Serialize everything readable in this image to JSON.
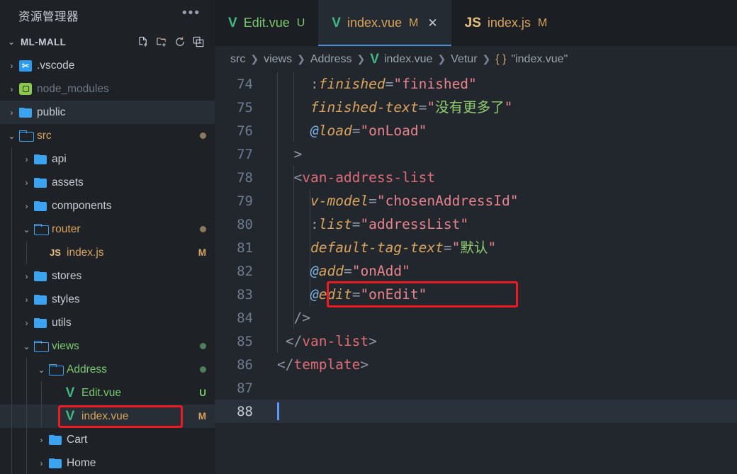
{
  "sidebar": {
    "title": "资源管理器",
    "more_icon": "ellipsis-icon",
    "root": {
      "name": "ML-MALL",
      "chevron": "⌄",
      "actions": [
        {
          "name": "new-file-icon",
          "tooltip": "New File"
        },
        {
          "name": "new-folder-icon",
          "tooltip": "New Folder"
        },
        {
          "name": "refresh-icon",
          "tooltip": "Refresh Explorer"
        },
        {
          "name": "collapse-all-icon",
          "tooltip": "Collapse Folders in Explorer"
        }
      ]
    },
    "items": [
      {
        "label": ".vscode",
        "type": "folder",
        "icon": "vscode-folder-icon",
        "chevron": "›",
        "indent": 1,
        "badge": "",
        "dot": "",
        "selected": false,
        "color": "#c8ccd4"
      },
      {
        "label": "node_modules",
        "type": "folder",
        "icon": "node-folder-icon",
        "chevron": "›",
        "indent": 1,
        "badge": "",
        "dot": "",
        "selected": false,
        "color": "#6f7783"
      },
      {
        "label": "public",
        "type": "folder",
        "icon": "folder-icon",
        "chevron": "›",
        "indent": 1,
        "badge": "",
        "dot": "",
        "selected": true,
        "color": "#c8ccd4"
      },
      {
        "label": "src",
        "type": "folder-open",
        "icon": "folder-open-icon",
        "chevron": "⌄",
        "indent": 1,
        "badge": "",
        "dot": "#8a7a5c",
        "selected": false,
        "color": "#d9a35c"
      },
      {
        "label": "api",
        "type": "folder",
        "icon": "folder-icon",
        "chevron": "›",
        "indent": 2,
        "badge": "",
        "dot": "",
        "selected": false,
        "color": "#c8ccd4"
      },
      {
        "label": "assets",
        "type": "folder",
        "icon": "folder-icon",
        "chevron": "›",
        "indent": 2,
        "badge": "",
        "dot": "",
        "selected": false,
        "color": "#c8ccd4"
      },
      {
        "label": "components",
        "type": "folder",
        "icon": "folder-icon",
        "chevron": "›",
        "indent": 2,
        "badge": "",
        "dot": "",
        "selected": false,
        "color": "#c8ccd4"
      },
      {
        "label": "router",
        "type": "folder-open",
        "icon": "folder-open-icon",
        "chevron": "⌄",
        "indent": 2,
        "badge": "",
        "dot": "#8a7a5c",
        "selected": false,
        "color": "#d9a35c"
      },
      {
        "label": "index.js",
        "type": "file-js",
        "icon": "js-file-icon",
        "chevron": "",
        "indent": 3,
        "badge": "M",
        "dot": "",
        "selected": false,
        "color": "#d9a35c",
        "badge_color": "#d9a35c"
      },
      {
        "label": "stores",
        "type": "folder",
        "icon": "folder-icon",
        "chevron": "›",
        "indent": 2,
        "badge": "",
        "dot": "",
        "selected": false,
        "color": "#c8ccd4"
      },
      {
        "label": "styles",
        "type": "folder",
        "icon": "folder-icon",
        "chevron": "›",
        "indent": 2,
        "badge": "",
        "dot": "",
        "selected": false,
        "color": "#c8ccd4"
      },
      {
        "label": "utils",
        "type": "folder",
        "icon": "folder-icon",
        "chevron": "›",
        "indent": 2,
        "badge": "",
        "dot": "",
        "selected": false,
        "color": "#c8ccd4"
      },
      {
        "label": "views",
        "type": "folder-open",
        "icon": "folder-open-icon",
        "chevron": "⌄",
        "indent": 2,
        "badge": "",
        "dot": "#4f7d5c",
        "selected": false,
        "color": "#7bc96f"
      },
      {
        "label": "Address",
        "type": "folder-open",
        "icon": "folder-open-icon",
        "chevron": "⌄",
        "indent": 3,
        "badge": "",
        "dot": "#4f7d5c",
        "selected": false,
        "color": "#7bc96f"
      },
      {
        "label": "Edit.vue",
        "type": "file-vue",
        "icon": "vue-file-icon",
        "chevron": "",
        "indent": 4,
        "badge": "U",
        "dot": "",
        "selected": false,
        "color": "#7bc96f",
        "badge_color": "#7bc96f"
      },
      {
        "label": "index.vue",
        "type": "file-vue",
        "icon": "vue-file-icon",
        "chevron": "",
        "indent": 4,
        "badge": "M",
        "dot": "",
        "selected": true,
        "color": "#d9a35c",
        "badge_color": "#d9a35c",
        "highlighted": true
      },
      {
        "label": "Cart",
        "type": "folder",
        "icon": "folder-icon",
        "chevron": "›",
        "indent": 3,
        "badge": "",
        "dot": "",
        "selected": false,
        "color": "#c8ccd4"
      },
      {
        "label": "Home",
        "type": "folder",
        "icon": "folder-icon",
        "chevron": "›",
        "indent": 3,
        "badge": "",
        "dot": "",
        "selected": false,
        "color": "#c8ccd4"
      }
    ]
  },
  "tabs": [
    {
      "name": "Edit.vue",
      "mark": "U",
      "icon": "vue-file-icon",
      "active": false,
      "closable": false,
      "color": "#7bc96f",
      "mark_color": "#7bc96f"
    },
    {
      "name": "index.vue",
      "mark": "M",
      "icon": "vue-file-icon",
      "active": true,
      "closable": true,
      "close_icon": "close-icon",
      "color": "#d9a35c",
      "mark_color": "#d9a35c"
    },
    {
      "name": "index.js",
      "mark": "M",
      "icon": "js-file-icon",
      "active": false,
      "closable": false,
      "color": "#d9a35c",
      "mark_color": "#d9a35c"
    }
  ],
  "breadcrumb": [
    {
      "label": "src",
      "icon": ""
    },
    {
      "label": "views",
      "icon": ""
    },
    {
      "label": "Address",
      "icon": ""
    },
    {
      "label": "index.vue",
      "icon": "vue-file-icon"
    },
    {
      "label": "Vetur",
      "icon": ""
    },
    {
      "label": "\"index.vue\"",
      "icon": "braces-icon"
    }
  ],
  "editor": {
    "first_line": 74,
    "cursor_line": 88,
    "lines": [
      {
        "num": "74",
        "indent_guides": 2,
        "tokens": [
          {
            "t": "    ",
            "c": "punct"
          },
          {
            "t": ":",
            "c": "punct"
          },
          {
            "t": "finished",
            "c": "attr"
          },
          {
            "t": "=",
            "c": "eq"
          },
          {
            "t": "\"finished\"",
            "c": "str"
          }
        ]
      },
      {
        "num": "75",
        "indent_guides": 2,
        "tokens": [
          {
            "t": "    ",
            "c": "punct"
          },
          {
            "t": "finished-text",
            "c": "attr"
          },
          {
            "t": "=",
            "c": "eq"
          },
          {
            "t": "\"",
            "c": "str"
          },
          {
            "t": "没有更多了",
            "c": "cjk"
          },
          {
            "t": "\"",
            "c": "str"
          }
        ]
      },
      {
        "num": "76",
        "indent_guides": 2,
        "tokens": [
          {
            "t": "    ",
            "c": "punct"
          },
          {
            "t": "@",
            "c": "at"
          },
          {
            "t": "load",
            "c": "attr"
          },
          {
            "t": "=",
            "c": "eq"
          },
          {
            "t": "\"onLoad\"",
            "c": "str"
          }
        ]
      },
      {
        "num": "77",
        "indent_guides": 1,
        "tokens": [
          {
            "t": "  ",
            "c": "punct"
          },
          {
            "t": ">",
            "c": "punct"
          }
        ]
      },
      {
        "num": "78",
        "indent_guides": 2,
        "tokens": [
          {
            "t": "  ",
            "c": "punct"
          },
          {
            "t": "<",
            "c": "punct"
          },
          {
            "t": "van-address-list",
            "c": "tag"
          }
        ]
      },
      {
        "num": "79",
        "indent_guides": 3,
        "tokens": [
          {
            "t": "    ",
            "c": "punct"
          },
          {
            "t": "v-model",
            "c": "attr"
          },
          {
            "t": "=",
            "c": "eq"
          },
          {
            "t": "\"chosenAddressId\"",
            "c": "str"
          }
        ]
      },
      {
        "num": "80",
        "indent_guides": 3,
        "tokens": [
          {
            "t": "    ",
            "c": "punct"
          },
          {
            "t": ":",
            "c": "punct"
          },
          {
            "t": "list",
            "c": "attr"
          },
          {
            "t": "=",
            "c": "eq"
          },
          {
            "t": "\"addressList\"",
            "c": "str"
          }
        ]
      },
      {
        "num": "81",
        "indent_guides": 3,
        "tokens": [
          {
            "t": "    ",
            "c": "punct"
          },
          {
            "t": "default-tag-text",
            "c": "attr"
          },
          {
            "t": "=",
            "c": "eq"
          },
          {
            "t": "\"",
            "c": "str"
          },
          {
            "t": "默认",
            "c": "cjk"
          },
          {
            "t": "\"",
            "c": "str"
          }
        ]
      },
      {
        "num": "82",
        "indent_guides": 3,
        "tokens": [
          {
            "t": "    ",
            "c": "punct"
          },
          {
            "t": "@",
            "c": "at"
          },
          {
            "t": "add",
            "c": "attr"
          },
          {
            "t": "=",
            "c": "eq"
          },
          {
            "t": "\"onAdd\"",
            "c": "str"
          }
        ]
      },
      {
        "num": "83",
        "indent_guides": 3,
        "highlighted": true,
        "tokens": [
          {
            "t": "    ",
            "c": "punct"
          },
          {
            "t": "@",
            "c": "at"
          },
          {
            "t": "edit",
            "c": "attr"
          },
          {
            "t": "=",
            "c": "eq"
          },
          {
            "t": "\"onEdit\"",
            "c": "str"
          }
        ]
      },
      {
        "num": "84",
        "indent_guides": 2,
        "tokens": [
          {
            "t": "  ",
            "c": "punct"
          },
          {
            "t": "/>",
            "c": "punct"
          }
        ]
      },
      {
        "num": "85",
        "indent_guides": 1,
        "tokens": [
          {
            "t": " ",
            "c": "punct"
          },
          {
            "t": "</",
            "c": "punct"
          },
          {
            "t": "van-list",
            "c": "tag"
          },
          {
            "t": ">",
            "c": "punct"
          }
        ]
      },
      {
        "num": "86",
        "indent_guides": 0,
        "tokens": [
          {
            "t": "</",
            "c": "punct"
          },
          {
            "t": "template",
            "c": "tag"
          },
          {
            "t": ">",
            "c": "punct"
          }
        ]
      },
      {
        "num": "87",
        "indent_guides": 0,
        "tokens": []
      },
      {
        "num": "88",
        "indent_guides": 0,
        "active": true,
        "cursor": true,
        "tokens": []
      }
    ]
  },
  "annotations": {
    "color": "#ee1c22",
    "boxes": [
      {
        "target": "code-line-83",
        "label": "@edit=\"onEdit\""
      },
      {
        "target": "sidebar-item-index-vue",
        "label": "index.vue"
      }
    ]
  }
}
